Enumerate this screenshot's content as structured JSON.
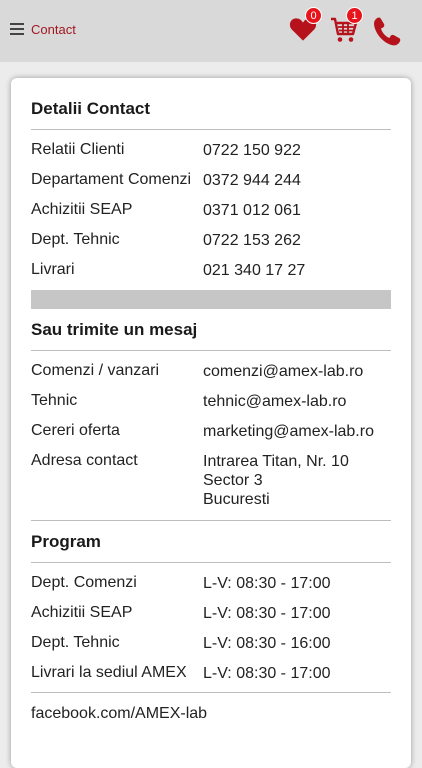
{
  "header": {
    "title": "Contact",
    "wishlist_count": "0",
    "cart_count": "1"
  },
  "colors": {
    "brand": "#a01820",
    "badge": "#e8141c"
  },
  "icons": {
    "menu": "hamburger-icon",
    "wishlist": "heart-icon",
    "cart": "cart-icon",
    "phone": "phone-icon"
  },
  "contact": {
    "heading": "Detalii Contact",
    "rows": [
      {
        "label": "Relatii Clienti",
        "value": "0722 150 922"
      },
      {
        "label": "Departament Comenzi",
        "value": "0372 944 244"
      },
      {
        "label": "Achizitii SEAP",
        "value": "0371 012 061"
      },
      {
        "label": "Dept. Tehnic",
        "value": "0722 153 262"
      },
      {
        "label": "Livrari",
        "value": "021 340 17 27"
      }
    ]
  },
  "message": {
    "heading": "Sau trimite un mesaj",
    "rows": [
      {
        "label": "Comenzi / vanzari",
        "value": "comenzi@amex-lab.ro"
      },
      {
        "label": "Tehnic",
        "value": "tehnic@amex-lab.ro"
      },
      {
        "label": "Cereri oferta",
        "value": "marketing@amex-lab.ro"
      }
    ],
    "address": {
      "label": "Adresa contact",
      "line1": "Intrarea Titan, Nr. 10",
      "line2": "Sector 3",
      "line3": "Bucuresti"
    }
  },
  "program": {
    "heading": "Program",
    "rows": [
      {
        "label": "Dept. Comenzi",
        "value": "L-V: 08:30 - 17:00"
      },
      {
        "label": "Achizitii SEAP",
        "value": "L-V: 08:30 - 17:00"
      },
      {
        "label": "Dept. Tehnic",
        "value": "L-V: 08:30 - 16:00"
      },
      {
        "label": "Livrari la sediul AMEX",
        "value": "L-V: 08:30 - 17:00"
      }
    ]
  },
  "footer": {
    "facebook": "facebook.com/AMEX-lab"
  }
}
